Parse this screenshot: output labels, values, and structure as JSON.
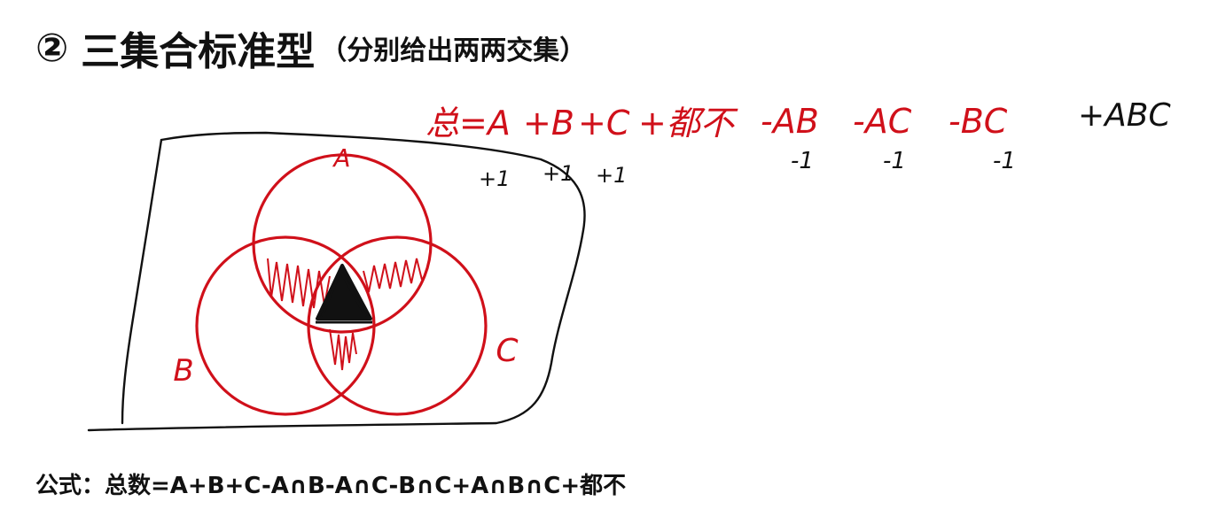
{
  "title": {
    "number": "②",
    "main": "三集合标准型",
    "sub": "（分别给出两两交集）"
  },
  "venn": {
    "set_labels": [
      "A",
      "B",
      "C"
    ]
  },
  "handwritten": {
    "formula_red_parts": [
      "总=A",
      "+B",
      "+C",
      "+都不",
      "-AB",
      "-AC",
      "-BC"
    ],
    "formula_black_part": "+ABC",
    "marks_plus": [
      "+1",
      "+1",
      "+1"
    ],
    "marks_minus": [
      "-1",
      "-1",
      "-1"
    ]
  },
  "formula_line": "公式：总数=A+B+C-A∩B-A∩C-B∩C+A∩B∩C+都不",
  "colors": {
    "red": "#d0101a",
    "ink": "#111111"
  }
}
